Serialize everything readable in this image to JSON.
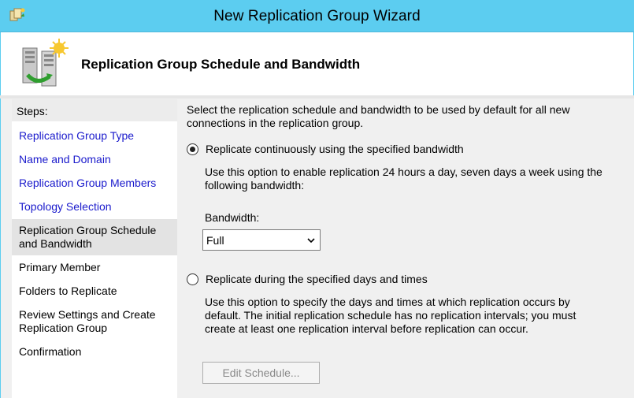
{
  "window": {
    "title": "New Replication Group Wizard"
  },
  "header": {
    "title": "Replication Group Schedule and Bandwidth"
  },
  "steps": {
    "header": "Steps:",
    "items": [
      {
        "label": "Replication Group Type",
        "state": "link"
      },
      {
        "label": "Name and Domain",
        "state": "link"
      },
      {
        "label": "Replication Group Members",
        "state": "link"
      },
      {
        "label": "Topology Selection",
        "state": "link"
      },
      {
        "label": "Replication Group Schedule and Bandwidth",
        "state": "current"
      },
      {
        "label": "Primary Member",
        "state": "plain"
      },
      {
        "label": "Folders to Replicate",
        "state": "plain"
      },
      {
        "label": "Review Settings and Create Replication Group",
        "state": "plain"
      },
      {
        "label": "Confirmation",
        "state": "plain"
      }
    ]
  },
  "main": {
    "description": "Select the replication schedule and bandwidth to be used by default for all new connections in the replication group.",
    "option_continuous": {
      "label": "Replicate continuously using the specified bandwidth",
      "checked": true,
      "help": "Use this option to enable replication 24 hours a day, seven days a week using the following bandwidth:"
    },
    "bandwidth": {
      "label": "Bandwidth:",
      "value": "Full"
    },
    "option_scheduled": {
      "label": "Replicate during the specified days and times",
      "checked": false,
      "help": "Use this option to specify the days and times at which replication occurs by default. The initial replication schedule has no replication intervals; you must create at least one replication interval before replication can occur."
    },
    "edit_schedule_label": "Edit Schedule..."
  },
  "colors": {
    "titlebar": "#5ccdf0",
    "link": "#1a1acc",
    "panel": "#f0f0f0"
  }
}
